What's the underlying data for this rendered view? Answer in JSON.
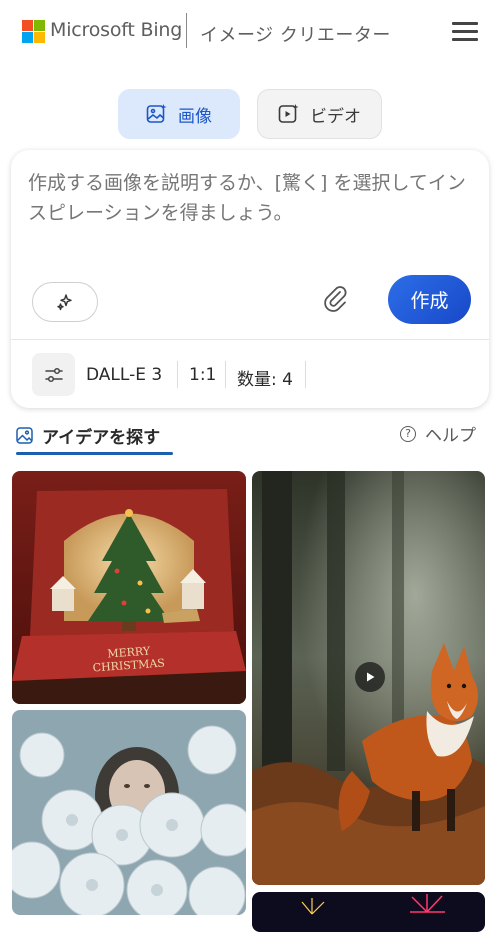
{
  "header": {
    "brand": "Microsoft Bing",
    "product": "イメージ クリエーター",
    "menu_icon": "hamburger-menu-icon"
  },
  "modes": [
    {
      "label": "画像",
      "icon": "image-sparkle-icon",
      "selected": true
    },
    {
      "label": "ビデオ",
      "icon": "video-sparkle-icon",
      "selected": false
    }
  ],
  "prompt": {
    "placeholder": "作成する画像を説明するか、[驚く] を選択してインスピレーションを得ましょう。",
    "surprise_icon": "sparkle-icon",
    "attach_icon": "paperclip-icon",
    "create_label": "作成"
  },
  "options": {
    "settings_icon": "sliders-icon",
    "model": "DALL-E 3",
    "ratio": "1:1",
    "quantity": "数量: 4"
  },
  "explore": {
    "label": "アイデアを探す",
    "icon": "image-icon",
    "help_label": "ヘルプ",
    "help_icon": "help-circle-icon"
  },
  "gallery": [
    {
      "subject": "christmas-popup-card",
      "card_text_line1": "MERRY",
      "card_text_line2": "CHRISTMAS"
    },
    {
      "subject": "fox-in-forest",
      "is_video": true,
      "play_icon": "play-icon"
    },
    {
      "subject": "woman-among-white-flowers"
    },
    {
      "subject": "fireworks"
    }
  ],
  "colors": {
    "accent": "#1b57c8",
    "create_button": "#1f5ad6",
    "tab_selected_bg": "#dce8fb",
    "explore_underline": "#1b5fb0"
  }
}
